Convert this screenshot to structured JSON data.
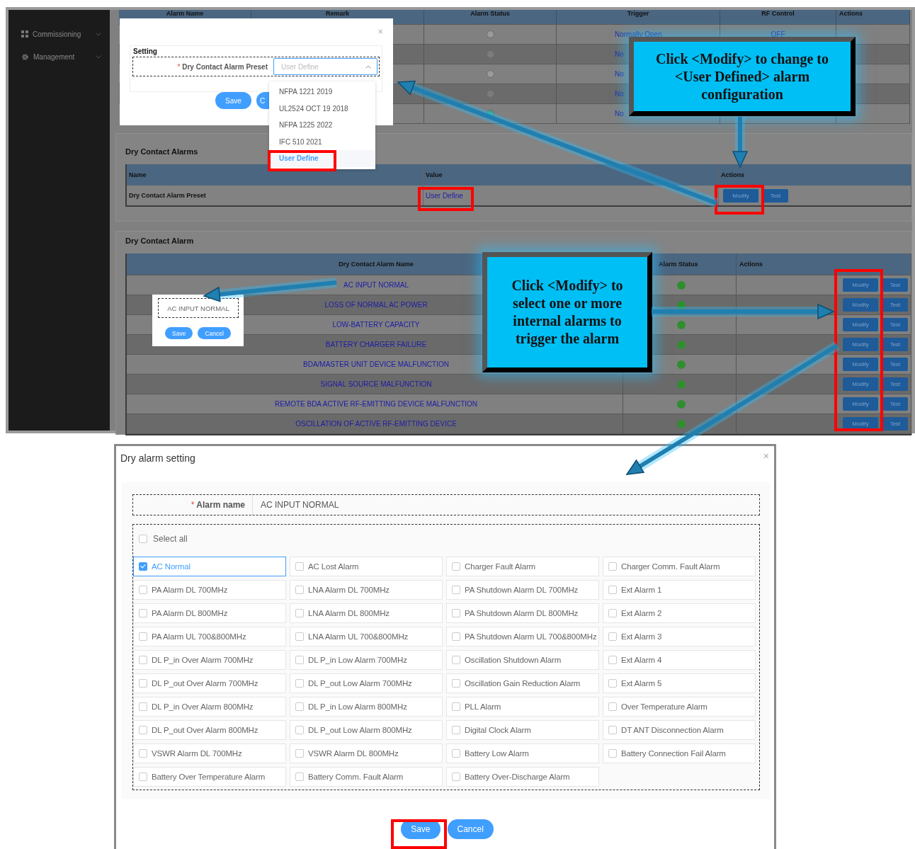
{
  "sidebar": {
    "items": [
      {
        "label": "Commissioning",
        "kind": "grid"
      },
      {
        "label": "Management",
        "kind": "gear"
      }
    ]
  },
  "alarm_table": {
    "columns": [
      "Alarm Name",
      "Remark",
      "Alarm Status",
      "Trigger",
      "RF Control",
      "Actions"
    ],
    "rows": [
      {
        "color": "#9a9a9a",
        "trigger": "Normally Open",
        "rf_control": "OFF"
      },
      {
        "color": "#7c7c7c",
        "trigger": "No"
      },
      {
        "color": "#9a9a9a",
        "trigger": "No"
      },
      {
        "color": "#7c7c7c",
        "trigger": "No"
      },
      {
        "color": "#3aa58a",
        "trigger": "No"
      }
    ]
  },
  "dry_contact_alarms": {
    "title": "Dry Contact Alarms",
    "columns": [
      "Name",
      "Value",
      "Actions"
    ],
    "rows": [
      {
        "name": "Dry Contact Alarm Preset",
        "value": "User Define",
        "actions": [
          "Modify",
          "Test"
        ]
      }
    ]
  },
  "dry_contact_alarm": {
    "title": "Dry Contact Alarm",
    "columns": [
      "Dry Contact Alarm Name",
      "Alarm Status",
      "Actions"
    ],
    "rows": [
      {
        "name": "AC INPUT NORMAL",
        "color": "#2f8f2f",
        "actions": [
          "Modify",
          "Test"
        ]
      },
      {
        "name": "LOSS OF NORMAL AC POWER",
        "color": "#2f8f2f",
        "actions": [
          "Modify",
          "Test"
        ]
      },
      {
        "name": "LOW-BATTERY CAPACITY",
        "color": "#2f8f2f",
        "actions": [
          "Modify",
          "Test"
        ]
      },
      {
        "name": "BATTERY CHARGER FAILURE",
        "color": "#2f8f2f",
        "actions": [
          "Modify",
          "Test"
        ]
      },
      {
        "name": "BDA/MASTER UNIT DEVICE MALFUNCTION",
        "color": "#2f8f2f",
        "actions": [
          "Modify",
          "Test"
        ]
      },
      {
        "name": "SIGNAL SOURCE MALFUNCTION",
        "color": "#2f8f2f",
        "actions": [
          "Modify",
          "Test"
        ]
      },
      {
        "name": "REMOTE BDA ACTIVE RF-EMITTING DEVICE MALFUNCTION",
        "color": "#2f8f2f",
        "actions": [
          "Modify",
          "Test"
        ]
      },
      {
        "name": "OSCILLATION OF ACTIVE RF-EMITTING DEVICE",
        "color": "#2f8f2f",
        "actions": [
          "Modify",
          "Test"
        ]
      }
    ]
  },
  "setting_modal": {
    "close": "×",
    "required_mark": "*",
    "section_title": "Setting",
    "field_label": "Dry Contact Alarm Preset",
    "required": true,
    "placeholder": "User Define",
    "expanded": true,
    "options": [
      {
        "label": "NFPA 1221 2019",
        "selected": false
      },
      {
        "label": "UL2524 OCT 19 2018",
        "selected": false
      },
      {
        "label": "NFPA 1225 2022",
        "selected": false
      },
      {
        "label": "IFC 510 2021",
        "selected": false
      },
      {
        "label": "User Define",
        "selected": true
      }
    ],
    "buttons": [
      "Save",
      "C"
    ]
  },
  "name_popup": {
    "value": "AC INPUT NORMAL",
    "buttons": [
      "Save",
      "Cancel"
    ]
  },
  "callouts": [
    "Click <Modify> to change to <User Defined> alarm configuration",
    "Click <Modify> to select one or more internal alarms to trigger the alarm"
  ],
  "dry_alarm_dialog": {
    "title": "Dry alarm setting",
    "close": "×",
    "required_mark": "*",
    "alarm_name_label": "Alarm name",
    "required": true,
    "alarm_name_value": "AC INPUT NORMAL",
    "select_all": {
      "label": "Select all",
      "checked": false
    },
    "options": [
      {
        "label": "AC Normal",
        "checked": true
      },
      {
        "label": "AC Lost Alarm",
        "checked": false
      },
      {
        "label": "Charger Fault Alarm",
        "checked": false
      },
      {
        "label": "Charger Comm. Fault Alarm",
        "checked": false
      },
      {
        "label": "PA Alarm DL 700MHz",
        "checked": false
      },
      {
        "label": "LNA Alarm DL 700MHz",
        "checked": false
      },
      {
        "label": "PA Shutdown Alarm DL 700MHz",
        "checked": false
      },
      {
        "label": "Ext Alarm 1",
        "checked": false
      },
      {
        "label": "PA Alarm DL 800MHz",
        "checked": false
      },
      {
        "label": "LNA Alarm DL 800MHz",
        "checked": false
      },
      {
        "label": "PA Shutdown Alarm DL 800MHz",
        "checked": false
      },
      {
        "label": "Ext Alarm 2",
        "checked": false
      },
      {
        "label": "PA Alarm UL 700&800MHz",
        "checked": false
      },
      {
        "label": "LNA Alarm UL 700&800MHz",
        "checked": false
      },
      {
        "label": "PA Shutdown Alarm UL 700&800MHz",
        "checked": false
      },
      {
        "label": "Ext Alarm 3",
        "checked": false
      },
      {
        "label": "DL P_in Over Alarm 700MHz",
        "checked": false
      },
      {
        "label": "DL P_in Low Alarm 700MHz",
        "checked": false
      },
      {
        "label": "Oscillation Shutdown Alarm",
        "checked": false
      },
      {
        "label": "Ext Alarm 4",
        "checked": false
      },
      {
        "label": "DL P_out Over Alarm 700MHz",
        "checked": false
      },
      {
        "label": "DL P_out Low Alarm 700MHz",
        "checked": false
      },
      {
        "label": "Oscillation Gain Reduction Alarm",
        "checked": false
      },
      {
        "label": "Ext Alarm 5",
        "checked": false
      },
      {
        "label": "DL P_in Over Alarm 800MHz",
        "checked": false
      },
      {
        "label": "DL P_in Low Alarm 800MHz",
        "checked": false
      },
      {
        "label": "PLL Alarm",
        "checked": false
      },
      {
        "label": "Over Temperature Alarm",
        "checked": false
      },
      {
        "label": "DL P_out Over Alarm 800MHz",
        "checked": false
      },
      {
        "label": "DL P_out Low Alarm 800MHz",
        "checked": false
      },
      {
        "label": "Digital Clock Alarm",
        "checked": false
      },
      {
        "label": "DT ANT Disconnection Alarm",
        "checked": false
      },
      {
        "label": "VSWR Alarm DL 700MHz",
        "checked": false
      },
      {
        "label": "VSWR Alarm DL 800MHz",
        "checked": false
      },
      {
        "label": "Battery Low Alarm",
        "checked": false
      },
      {
        "label": "Battery Connection Fail Alarm",
        "checked": false
      },
      {
        "label": "Battery Over Temperature Alarm",
        "checked": false
      },
      {
        "label": "Battery Comm. Fault Alarm",
        "checked": false
      },
      {
        "label": "Battery Over-Discharge Alarm",
        "checked": false
      }
    ],
    "buttons": [
      "Save",
      "Cancel"
    ]
  }
}
